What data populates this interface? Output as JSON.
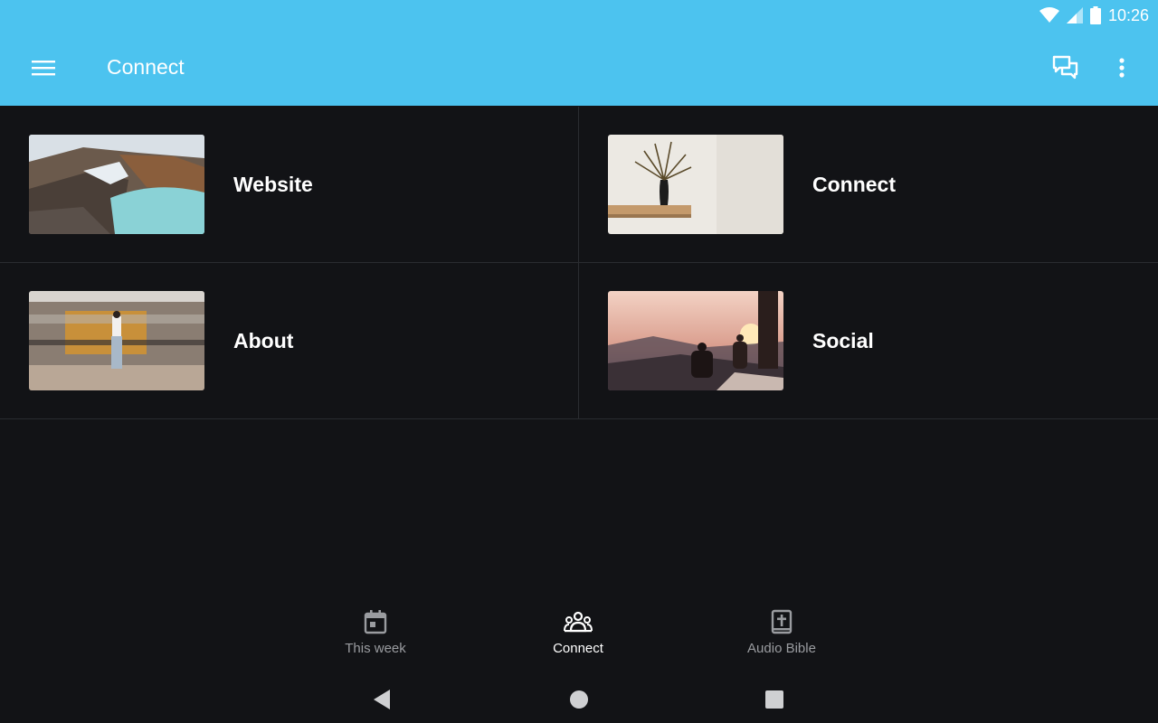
{
  "status_bar": {
    "time": "10:26"
  },
  "app_bar": {
    "title": "Connect"
  },
  "tiles": [
    {
      "label": "Website",
      "image": "crater-lake-photo"
    },
    {
      "label": "Connect",
      "image": "vase-on-shelf-photo"
    },
    {
      "label": "About",
      "image": "train-platform-photo"
    },
    {
      "label": "Social",
      "image": "sunset-hikers-photo"
    }
  ],
  "bottom_nav": [
    {
      "label": "This week",
      "icon": "calendar-icon",
      "active": false
    },
    {
      "label": "Connect",
      "icon": "group-icon",
      "active": true
    },
    {
      "label": "Audio Bible",
      "icon": "bible-icon",
      "active": false
    }
  ],
  "colors": {
    "accent": "#4cc3ef",
    "background": "#121316",
    "divider": "#2a2c30",
    "inactive": "#9a9ca0"
  }
}
